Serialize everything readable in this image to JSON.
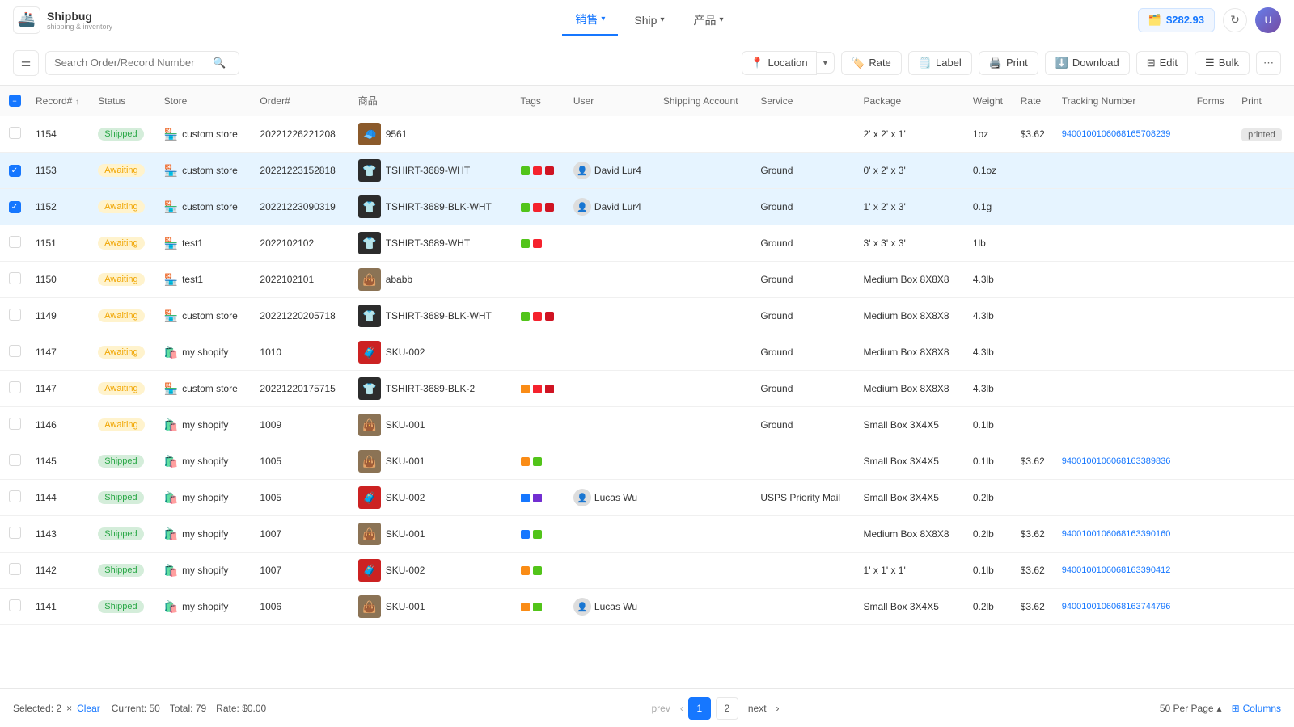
{
  "app": {
    "name": "Shipbug",
    "subtitle": "shipping & inventory",
    "balance": "$282.93"
  },
  "nav": {
    "tabs": [
      {
        "label": "销售",
        "active": true
      },
      {
        "label": "Ship",
        "active": false
      },
      {
        "label": "产品",
        "active": false
      }
    ]
  },
  "toolbar": {
    "search_placeholder": "Search Order/Record Number",
    "location_label": "Location",
    "rate_label": "Rate",
    "label_label": "Label",
    "print_label": "Print",
    "download_label": "Download",
    "edit_label": "Edit",
    "bulk_label": "Bulk"
  },
  "table": {
    "columns": [
      "Record#",
      "Status",
      "Store",
      "Order#",
      "商品",
      "Tags",
      "User",
      "Shipping Account",
      "Service",
      "Package",
      "Weight",
      "Rate",
      "Tracking Number",
      "Forms",
      "Print"
    ],
    "rows": [
      {
        "record": "1154",
        "status": "Shipped",
        "store": "custom store",
        "store_type": "custom",
        "order": "20221226221208",
        "product": "9561",
        "product_type": "hat",
        "tags": [],
        "user": "",
        "shipping_account": "",
        "service": "",
        "package": "2' x 2' x 1'",
        "weight": "1oz",
        "rate": "$3.62",
        "tracking": "94001001060681657082​39",
        "forms": "",
        "print": "printed",
        "selected": false
      },
      {
        "record": "1153",
        "status": "Awaiting",
        "store": "custom store",
        "store_type": "custom",
        "order": "20221223152818",
        "product": "TSHIRT-3689-WHT",
        "product_type": "tshirt",
        "tags": [
          "green",
          "red",
          "red2"
        ],
        "user": "David Lur4",
        "shipping_account": "",
        "service": "Ground",
        "package": "0' x 2' x 3'",
        "weight": "0.1oz",
        "rate": "",
        "tracking": "",
        "forms": "",
        "print": "",
        "selected": true
      },
      {
        "record": "1152",
        "status": "Awaiting",
        "store": "custom store",
        "store_type": "custom",
        "order": "20221223090319",
        "product": "TSHIRT-3689-BLK-WHT",
        "product_type": "tshirt",
        "tags": [
          "green",
          "red",
          "red2"
        ],
        "user": "David Lur4",
        "shipping_account": "",
        "service": "Ground",
        "package": "1' x 2' x 3'",
        "weight": "0.1g",
        "rate": "",
        "tracking": "",
        "forms": "",
        "print": "",
        "selected": true
      },
      {
        "record": "1151",
        "status": "Awaiting",
        "store": "test1",
        "store_type": "custom",
        "order": "2022102102",
        "product": "TSHIRT-3689-WHT",
        "product_type": "tshirt",
        "tags": [
          "green",
          "red"
        ],
        "user": "",
        "shipping_account": "",
        "service": "Ground",
        "package": "3' x 3' x 3'",
        "weight": "1lb",
        "rate": "",
        "tracking": "",
        "forms": "",
        "print": "",
        "selected": false
      },
      {
        "record": "1150",
        "status": "Awaiting",
        "store": "test1",
        "store_type": "custom",
        "order": "2022102101",
        "product": "ababb",
        "product_type": "bag",
        "tags": [],
        "user": "",
        "shipping_account": "",
        "service": "Ground",
        "package": "Medium Box 8X8X8",
        "weight": "4.3lb",
        "rate": "",
        "tracking": "",
        "forms": "",
        "print": "",
        "selected": false
      },
      {
        "record": "1149",
        "status": "Awaiting",
        "store": "custom store",
        "store_type": "custom",
        "order": "20221220205718",
        "product": "TSHIRT-3689-BLK-WHT",
        "product_type": "tshirt",
        "tags": [
          "green",
          "red",
          "red2"
        ],
        "user": "",
        "shipping_account": "",
        "service": "Ground",
        "package": "Medium Box 8X8X8",
        "weight": "4.3lb",
        "rate": "",
        "tracking": "",
        "forms": "",
        "print": "",
        "selected": false
      },
      {
        "record": "1147",
        "status": "Awaiting",
        "store": "my shopify",
        "store_type": "shopify",
        "order": "1010",
        "product": "SKU-002",
        "product_type": "red-bag",
        "tags": [],
        "user": "",
        "shipping_account": "",
        "service": "Ground",
        "package": "Medium Box 8X8X8",
        "weight": "4.3lb",
        "rate": "",
        "tracking": "",
        "forms": "",
        "print": "",
        "selected": false
      },
      {
        "record": "1147",
        "status": "Awaiting",
        "store": "custom store",
        "store_type": "custom",
        "order": "20221220175715",
        "product": "TSHIRT-3689-BLK-2",
        "product_type": "tshirt2",
        "tags": [
          "orange",
          "red",
          "red2"
        ],
        "user": "",
        "shipping_account": "",
        "service": "Ground",
        "package": "Medium Box 8X8X8",
        "weight": "4.3lb",
        "rate": "",
        "tracking": "",
        "forms": "",
        "print": "",
        "selected": false
      },
      {
        "record": "1146",
        "status": "Awaiting",
        "store": "my shopify",
        "store_type": "shopify",
        "order": "1009",
        "product": "SKU-001",
        "product_type": "bag",
        "tags": [],
        "user": "",
        "shipping_account": "",
        "service": "Ground",
        "package": "Small Box 3X4X5",
        "weight": "0.1lb",
        "rate": "",
        "tracking": "",
        "forms": "",
        "print": "",
        "selected": false
      },
      {
        "record": "1145",
        "status": "Shipped",
        "store": "my shopify",
        "store_type": "shopify",
        "order": "1005",
        "product": "SKU-001",
        "product_type": "bag",
        "tags": [
          "orange",
          "green"
        ],
        "user": "",
        "shipping_account": "",
        "service": "",
        "package": "Small Box 3X4X5",
        "weight": "0.1lb",
        "rate": "$3.62",
        "tracking": "94001001060681633898​36",
        "forms": "",
        "print": "",
        "selected": false
      },
      {
        "record": "1144",
        "status": "Shipped",
        "store": "my shopify",
        "store_type": "shopify",
        "order": "1005",
        "product": "SKU-002",
        "product_type": "red-bag",
        "tags": [
          "blue",
          "purple"
        ],
        "user": "Lucas Wu",
        "shipping_account": "",
        "service": "USPS Priority Mail",
        "package": "Small Box 3X4X5",
        "weight": "0.2lb",
        "rate": "",
        "tracking": "",
        "forms": "",
        "print": "",
        "selected": false
      },
      {
        "record": "1143",
        "status": "Shipped",
        "store": "my shopify",
        "store_type": "shopify",
        "order": "1007",
        "product": "SKU-001",
        "product_type": "bag",
        "tags": [
          "blue",
          "green"
        ],
        "user": "",
        "shipping_account": "",
        "service": "",
        "package": "Medium Box 8X8X8",
        "weight": "0.2lb",
        "rate": "$3.62",
        "tracking": "94001001060681633901​60",
        "forms": "",
        "print": "",
        "selected": false
      },
      {
        "record": "1142",
        "status": "Shipped",
        "store": "my shopify",
        "store_type": "shopify",
        "order": "1007",
        "product": "SKU-002",
        "product_type": "red-bag",
        "tags": [
          "orange",
          "green"
        ],
        "user": "",
        "shipping_account": "",
        "service": "",
        "package": "1' x 1' x 1'",
        "weight": "0.1lb",
        "rate": "$3.62",
        "tracking": "94001001060681633904​12",
        "forms": "",
        "print": "",
        "selected": false
      },
      {
        "record": "1141",
        "status": "Shipped",
        "store": "my shopify",
        "store_type": "shopify",
        "order": "1006",
        "product": "SKU-001",
        "product_type": "bag",
        "tags": [
          "orange",
          "green"
        ],
        "user": "Lucas Wu",
        "shipping_account": "",
        "service": "",
        "package": "Small Box 3X4X5",
        "weight": "0.2lb",
        "rate": "$3.62",
        "tracking": "94001001060681637447​96",
        "forms": "",
        "print": "",
        "selected": false
      }
    ]
  },
  "pagination": {
    "selected_count": "2",
    "clear_label": "Clear",
    "current_label": "Current: 50",
    "total_label": "Total: 79",
    "rate_label": "Rate: $0.00",
    "prev_label": "prev",
    "next_label": "next",
    "page1": "1",
    "page2": "2",
    "per_page": "50 Per Page",
    "columns_label": "Columns"
  }
}
